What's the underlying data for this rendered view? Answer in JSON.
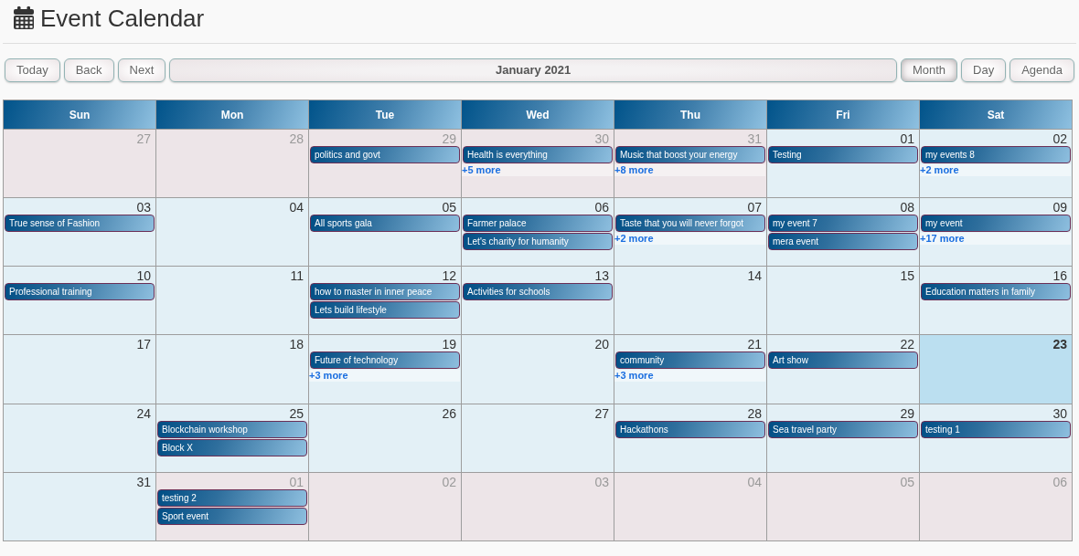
{
  "header": {
    "title": "Event Calendar"
  },
  "toolbar": {
    "nav_buttons": [
      "Today",
      "Back",
      "Next"
    ],
    "label": "January 2021",
    "views": [
      {
        "label": "Month",
        "selected": true
      },
      {
        "label": "Day",
        "selected": false
      },
      {
        "label": "Agenda",
        "selected": false
      }
    ]
  },
  "calendar": {
    "weekdays": [
      "Sun",
      "Mon",
      "Tue",
      "Wed",
      "Thu",
      "Fri",
      "Sat"
    ],
    "weeks": [
      {
        "days": [
          {
            "date": "27",
            "outside_month": true,
            "today": false
          },
          {
            "date": "28",
            "outside_month": true,
            "today": false
          },
          {
            "date": "29",
            "outside_month": true,
            "today": false,
            "events": [
              "politics and govt"
            ]
          },
          {
            "date": "30",
            "outside_month": true,
            "today": false,
            "events": [
              "Health is everything"
            ],
            "more": "+5 more"
          },
          {
            "date": "31",
            "outside_month": true,
            "today": false,
            "events": [
              "Music that boost your energy"
            ],
            "more": "+8 more"
          },
          {
            "date": "01",
            "outside_month": false,
            "today": false,
            "events": [
              "Testing"
            ]
          },
          {
            "date": "02",
            "outside_month": false,
            "today": false,
            "events": [
              "my events 8"
            ],
            "more": "+2 more"
          }
        ]
      },
      {
        "days": [
          {
            "date": "03",
            "outside_month": false,
            "today": false,
            "events": [
              "True sense of Fashion"
            ]
          },
          {
            "date": "04",
            "outside_month": false,
            "today": false
          },
          {
            "date": "05",
            "outside_month": false,
            "today": false,
            "events": [
              "All sports gala"
            ]
          },
          {
            "date": "06",
            "outside_month": false,
            "today": false,
            "events": [
              "Farmer palace",
              "Let's charity for humanity"
            ]
          },
          {
            "date": "07",
            "outside_month": false,
            "today": false,
            "events": [
              "Taste that you will never forgot"
            ],
            "more": "+2 more"
          },
          {
            "date": "08",
            "outside_month": false,
            "today": false,
            "events": [
              "my event 7",
              "mera event"
            ]
          },
          {
            "date": "09",
            "outside_month": false,
            "today": false,
            "events": [
              "my event"
            ],
            "more": "+17 more"
          }
        ]
      },
      {
        "days": [
          {
            "date": "10",
            "outside_month": false,
            "today": false,
            "events": [
              "Professional training"
            ]
          },
          {
            "date": "11",
            "outside_month": false,
            "today": false
          },
          {
            "date": "12",
            "outside_month": false,
            "today": false,
            "events": [
              "how to master in inner peace",
              "Lets build lifestyle"
            ]
          },
          {
            "date": "13",
            "outside_month": false,
            "today": false,
            "events": [
              "Activities for schools"
            ]
          },
          {
            "date": "14",
            "outside_month": false,
            "today": false
          },
          {
            "date": "15",
            "outside_month": false,
            "today": false
          },
          {
            "date": "16",
            "outside_month": false,
            "today": false,
            "events": [
              "Education matters in family"
            ]
          }
        ]
      },
      {
        "days": [
          {
            "date": "17",
            "outside_month": false,
            "today": false
          },
          {
            "date": "18",
            "outside_month": false,
            "today": false
          },
          {
            "date": "19",
            "outside_month": false,
            "today": false,
            "events": [
              "Future of technology"
            ],
            "more": "+3 more"
          },
          {
            "date": "20",
            "outside_month": false,
            "today": false
          },
          {
            "date": "21",
            "outside_month": false,
            "today": false,
            "events": [
              "community"
            ],
            "more": "+3 more"
          },
          {
            "date": "22",
            "outside_month": false,
            "today": false,
            "events": [
              "Art show"
            ]
          },
          {
            "date": "23",
            "outside_month": false,
            "today": true
          }
        ]
      },
      {
        "days": [
          {
            "date": "24",
            "outside_month": false,
            "today": false
          },
          {
            "date": "25",
            "outside_month": false,
            "today": false,
            "events": [
              "Blockchain workshop",
              "Block X"
            ]
          },
          {
            "date": "26",
            "outside_month": false,
            "today": false
          },
          {
            "date": "27",
            "outside_month": false,
            "today": false
          },
          {
            "date": "28",
            "outside_month": false,
            "today": false,
            "events": [
              "Hackathons"
            ]
          },
          {
            "date": "29",
            "outside_month": false,
            "today": false,
            "events": [
              "Sea travel party"
            ]
          },
          {
            "date": "30",
            "outside_month": false,
            "today": false,
            "events": [
              "testing 1"
            ]
          }
        ]
      },
      {
        "days": [
          {
            "date": "31",
            "outside_month": false,
            "today": false
          },
          {
            "date": "01",
            "outside_month": true,
            "today": false,
            "events": [
              "testing 2",
              "Sport event"
            ]
          },
          {
            "date": "02",
            "outside_month": true,
            "today": false
          },
          {
            "date": "03",
            "outside_month": true,
            "today": false
          },
          {
            "date": "04",
            "outside_month": true,
            "today": false
          },
          {
            "date": "05",
            "outside_month": true,
            "today": false
          },
          {
            "date": "06",
            "outside_month": true,
            "today": false
          }
        ]
      }
    ]
  }
}
